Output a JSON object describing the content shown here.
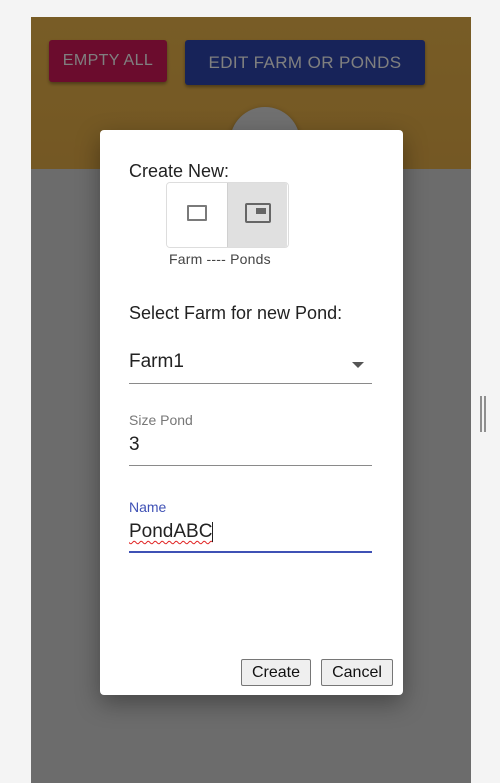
{
  "toolbar": {
    "empty_all_label": "EMPTY ALL",
    "edit_label": "EDIT FARM OR PONDS",
    "fab_symbol": "+"
  },
  "dialog": {
    "create_new_label": "Create New:",
    "toggle": {
      "options": [
        "Farm",
        "Ponds"
      ],
      "selected": "Ponds",
      "caption": "Farm ---- Ponds"
    },
    "select_farm_label": "Select Farm for new Pond:",
    "farm_select": {
      "value": "Farm1"
    },
    "size_field": {
      "label": "Size Pond",
      "value": "3"
    },
    "name_field": {
      "label": "Name",
      "value": "PondABC"
    },
    "create_label": "Create",
    "cancel_label": "Cancel"
  },
  "colors": {
    "header": "#f0b94c",
    "empty_all": "#d6185b",
    "edit": "#2f46b2",
    "focus_underline": "#3f51b5"
  }
}
